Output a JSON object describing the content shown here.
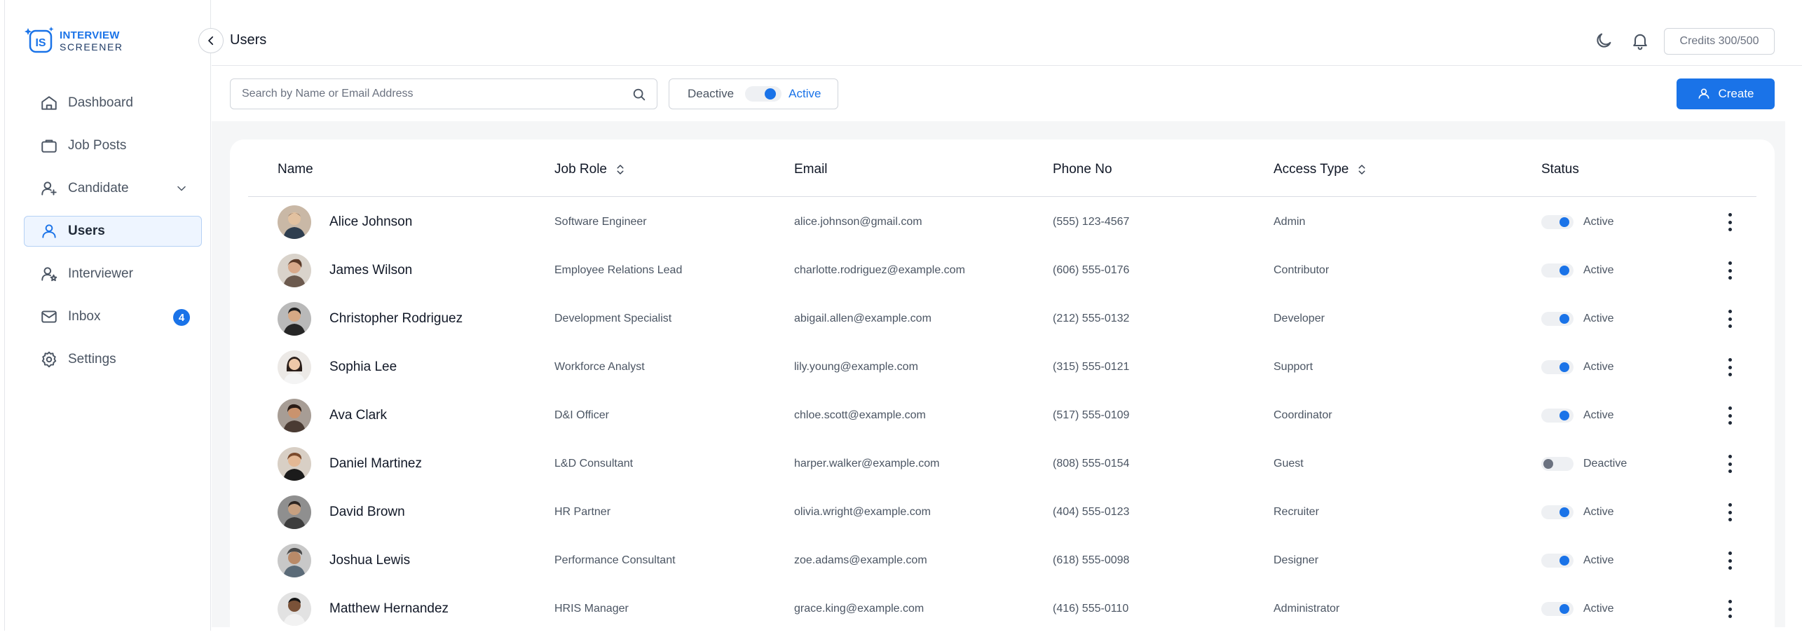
{
  "brand": {
    "line1": "INTERVIEW",
    "line2": "SCREENER",
    "mark": "IS"
  },
  "sidebar": {
    "items": [
      {
        "key": "dashboard",
        "label": "Dashboard",
        "icon": "home-icon"
      },
      {
        "key": "job-posts",
        "label": "Job Posts",
        "icon": "briefcase-icon"
      },
      {
        "key": "candidate",
        "label": "Candidate",
        "icon": "user-plus-icon"
      },
      {
        "key": "users",
        "label": "Users",
        "icon": "user-icon",
        "active": true
      },
      {
        "key": "interviewer",
        "label": "Interviewer",
        "icon": "user-star-icon"
      },
      {
        "key": "inbox",
        "label": "Inbox",
        "icon": "mail-icon",
        "badge": "4"
      },
      {
        "key": "settings",
        "label": "Settings",
        "icon": "gear-icon"
      }
    ]
  },
  "header": {
    "title": "Users",
    "credits": "Credits 300/500"
  },
  "toolbar": {
    "search_placeholder": "Search by Name or Email Address",
    "filter_off_label": "Deactive",
    "filter_on_label": "Active",
    "create_label": "Create"
  },
  "table": {
    "columns": {
      "name": "Name",
      "role": "Job Role",
      "email": "Email",
      "phone": "Phone No",
      "access": "Access Type",
      "status": "Status"
    },
    "rows": [
      {
        "name": "Alice Johnson",
        "role": "Software Engineer",
        "email": "alice.johnson@gmail.com",
        "phone": "(555) 123-4567",
        "access": "Admin",
        "status": "Active",
        "on": true
      },
      {
        "name": "James Wilson",
        "role": "Employee Relations Lead",
        "email": "charlotte.rodriguez@example.com",
        "phone": "(606) 555-0176",
        "access": "Contributor",
        "status": "Active",
        "on": true
      },
      {
        "name": "Christopher Rodriguez",
        "role": "Development Specialist",
        "email": "abigail.allen@example.com",
        "phone": "(212) 555-0132",
        "access": "Developer",
        "status": "Active",
        "on": true
      },
      {
        "name": "Sophia Lee",
        "role": "Workforce Analyst",
        "email": "lily.young@example.com",
        "phone": "(315) 555-0121",
        "access": "Support",
        "status": "Active",
        "on": true
      },
      {
        "name": "Ava Clark",
        "role": "D&I Officer",
        "email": "chloe.scott@example.com",
        "phone": "(517) 555-0109",
        "access": "Coordinator",
        "status": "Active",
        "on": true
      },
      {
        "name": "Daniel Martinez",
        "role": "L&D Consultant",
        "email": "harper.walker@example.com",
        "phone": "(808) 555-0154",
        "access": "Guest",
        "status": "Deactive",
        "on": false
      },
      {
        "name": "David Brown",
        "role": "HR Partner",
        "email": "olivia.wright@example.com",
        "phone": "(404) 555-0123",
        "access": "Recruiter",
        "status": "Active",
        "on": true
      },
      {
        "name": "Joshua Lewis",
        "role": "Performance Consultant",
        "email": "zoe.adams@example.com",
        "phone": "(618) 555-0098",
        "access": "Designer",
        "status": "Active",
        "on": true
      },
      {
        "name": "Matthew Hernandez",
        "role": "HRIS Manager",
        "email": "grace.king@example.com",
        "phone": "(416) 555-0110",
        "access": "Administrator",
        "status": "Active",
        "on": true
      }
    ]
  },
  "colors": {
    "accent": "#1a73e8",
    "active_bg": "#eef5ff"
  }
}
